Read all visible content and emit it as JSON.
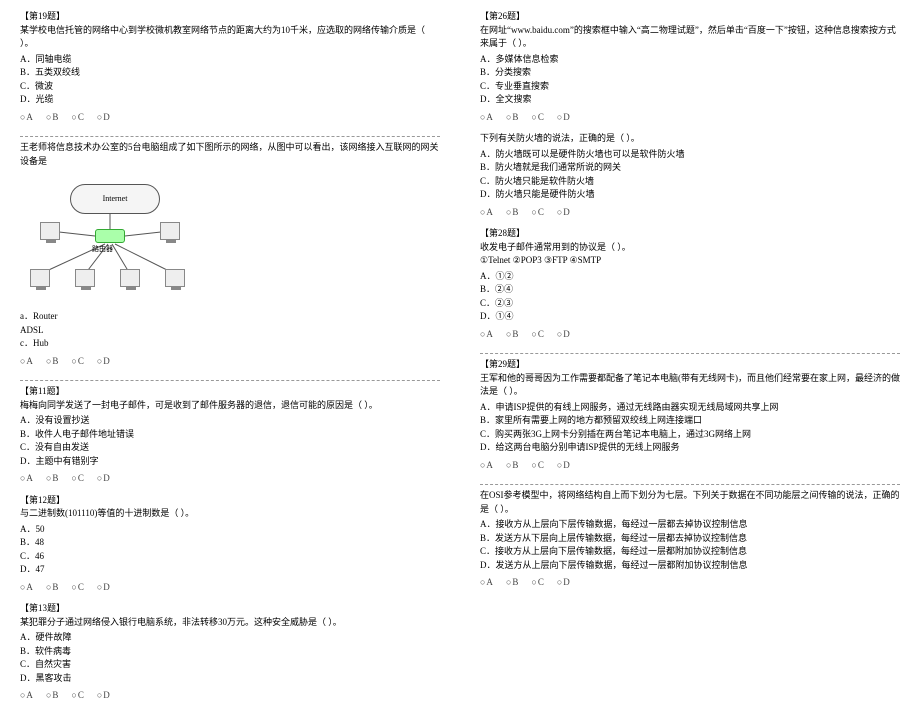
{
  "left": {
    "q19": {
      "heading": "【第19题】",
      "stem": "某学校电信托管的网络中心到学校微机教室网络节点的距离大约为10千米，应选取的网络传输介质是（  ）。",
      "opts": [
        "A．同轴电缆",
        "B．五类双绞线",
        "C．微波",
        "D．光缆"
      ],
      "radios": [
        "○A",
        "○B",
        "○C",
        "○D"
      ]
    },
    "q20": {
      "stem": "王老师将信息技术办公室的5台电脑组成了如下图所示的网络，从图中可以看出，该网络接入互联网的网关设备是",
      "cloud": "Internet",
      "router": "路由器",
      "opts": [
        "a．Router",
        "ADSL",
        "c．Hub"
      ],
      "radios": [
        "○A",
        "○B",
        "○C",
        "○D"
      ]
    },
    "q11": {
      "heading": "【第11题】",
      "stem": "梅梅向同学发送了一封电子邮件，可是收到了邮件服务器的退信，退信可能的原因是（  ）。",
      "opts": [
        "A．没有设置抄送",
        "B．收件人电子邮件地址错误",
        "C．没有自由发送",
        "D．主题中有错别字"
      ],
      "radios": [
        "○A",
        "○B",
        "○C",
        "○D"
      ]
    },
    "q12": {
      "heading": "【第12题】",
      "stem": "与二进制数(101110)等值的十进制数是（  ）。",
      "opts": [
        "A．50",
        "B．48",
        "C．46",
        "D．47"
      ],
      "radios": [
        "○A",
        "○B",
        "○C",
        "○D"
      ]
    },
    "q13": {
      "heading": "【第13题】",
      "stem": "某犯罪分子通过网络侵入银行电脑系统，非法转移30万元。这种安全威胁是（  ）。",
      "opts": [
        "A．硬件故障",
        "B．软件病毒",
        "C．自然灾害",
        "D．黑客攻击"
      ],
      "radios": [
        "○A",
        "○B",
        "○C",
        "○D"
      ]
    }
  },
  "right": {
    "q26": {
      "heading": "【第26题】",
      "stem": "在网址“www.baidu.com”的搜索框中输入“高二物理试题”，然后单击“百度一下”按钮，这种信息搜索按方式来属于（  ）。",
      "opts": [
        "A．多媒体信息检索",
        "B．分类搜索",
        "C．专业垂直搜索",
        "D．全文搜索"
      ],
      "radios": [
        "○A",
        "○B",
        "○C",
        "○D"
      ]
    },
    "q27": {
      "stem": "下列有关防火墙的说法，正确的是（  ）。",
      "opts": [
        "A．防火墙既可以是硬件防火墙也可以是软件防火墙",
        "B．防火墙就是我们通常所说的网关",
        "C．防火墙只能是软件防火墙",
        "D．防火墙只能是硬件防火墙"
      ],
      "radios": [
        "○A",
        "○B",
        "○C",
        "○D"
      ]
    },
    "q28": {
      "heading": "【第28题】",
      "stem": "收发电子邮件通常用到的协议是（  ）。",
      "protocols": "①Telnet  ②POP3  ③FTP  ④SMTP",
      "opts": [
        "A．①②",
        "B．②④",
        "C．②③",
        "D．①④"
      ],
      "radios": [
        "○A",
        "○B",
        "○C",
        "○D"
      ]
    },
    "q29": {
      "heading": "【第29题】",
      "stem": "王军和他的哥哥因为工作需要都配备了笔记本电脑(带有无线网卡)，而且他们经常要在家上网，最经济的做法是（  ）。",
      "opts": [
        "A．申请ISP提供的有线上网服务，通过无线路由器实现无线局域网共享上网",
        "B．家里所有需要上网的地方都预留双绞线上网连接端口",
        "C．购买两张3G上网卡分别插在两台笔记本电脑上，通过3G网络上网",
        "D．给这两台电脑分别申请ISP提供的无线上网服务"
      ],
      "radios": [
        "○A",
        "○B",
        "○C",
        "○D"
      ]
    },
    "q30": {
      "stem": "在OSI参考模型中，将网络结构自上而下划分为七层。下列关于数据在不同功能层之间传输的说法，正确的是（  ）。",
      "opts": [
        "A．接收方从上层向下层传输数据，每经过一层都去掉协议控制信息",
        "B．发送方从下层向上层传输数据，每经过一层都去掉协议控制信息",
        "C．接收方从上层向下层传输数据，每经过一层都附加协议控制信息",
        "D．发送方从上层向下层传输数据，每经过一层都附加协议控制信息"
      ],
      "radios": [
        "○A",
        "○B",
        "○C",
        "○D"
      ]
    }
  }
}
